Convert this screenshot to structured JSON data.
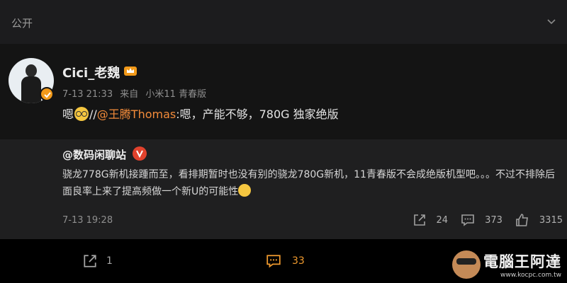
{
  "topbar": {
    "title": "公开",
    "chevron_icon": "chevron-down-icon"
  },
  "post": {
    "username": "Cici_老魏",
    "meta": {
      "date": "7-13 21:33",
      "source_prefix": "来自",
      "source": "小米11 青春版"
    },
    "content": {
      "prefix": "嗯",
      "separator": "//",
      "mention": "@王腾Thomas",
      "text": ":嗯，产能不够，780G 独家绝版"
    },
    "repost": {
      "username": "@数码闲聊站",
      "text": "骁龙778G新机接踵而至，看排期暂时也没有别的骁龙780G新机，11青春版不会成绝版机型吧。。。不过不排除后面良率上来了提高频做一个新U的可能性",
      "time": "7-13 19:28",
      "actions": {
        "reposts": "24",
        "comments": "373",
        "likes": "3315"
      }
    }
  },
  "bottom_bar": {
    "share_count": "1",
    "comment_count": "33"
  },
  "watermark": {
    "title": "電腦王阿達",
    "url": "www.kocpc.com.tw"
  },
  "colors": {
    "accent": "#f09a2e",
    "mention": "#f28b3a",
    "vip": "#f29a1a",
    "red_v": "#e2422d"
  }
}
